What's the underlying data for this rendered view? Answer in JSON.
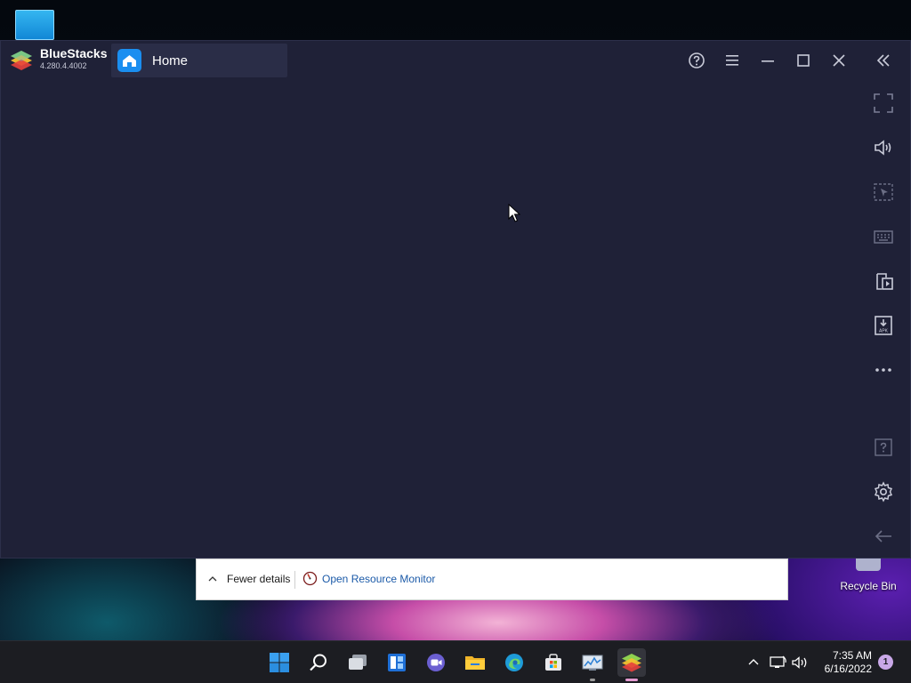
{
  "desktop": {
    "recycle_bin_label": "Recycle Bin"
  },
  "bluestacks": {
    "app_name": "BlueStacks",
    "version": "4.280.4.4002",
    "tab": {
      "label": "Home"
    },
    "title_controls": [
      "help-icon",
      "menu-icon",
      "minimize-icon",
      "maximize-icon",
      "close-icon",
      "collapse-sidebar-icon"
    ],
    "sidebar_icons": [
      "fullscreen-icon",
      "volume-icon",
      "macro-pointer-icon",
      "keyboard-icon",
      "multi-instance-icon",
      "install-apk-icon",
      "more-icon",
      "help-icon",
      "settings-icon",
      "back-icon"
    ],
    "colors": {
      "background": "#1f2137",
      "tab": "#2a2d47",
      "accent": "#1a8ef0"
    }
  },
  "task_manager": {
    "fewer_details": "Fewer details",
    "open_resource_monitor": "Open Resource Monitor"
  },
  "taskbar": {
    "apps": [
      "start-icon",
      "search-icon",
      "task-view-icon",
      "widgets-icon",
      "teams-chat-icon",
      "file-explorer-icon",
      "edge-icon",
      "store-icon",
      "resource-monitor-icon",
      "bluestacks-icon"
    ],
    "time": "7:35 AM",
    "date": "6/16/2022",
    "notification_count": "1"
  }
}
